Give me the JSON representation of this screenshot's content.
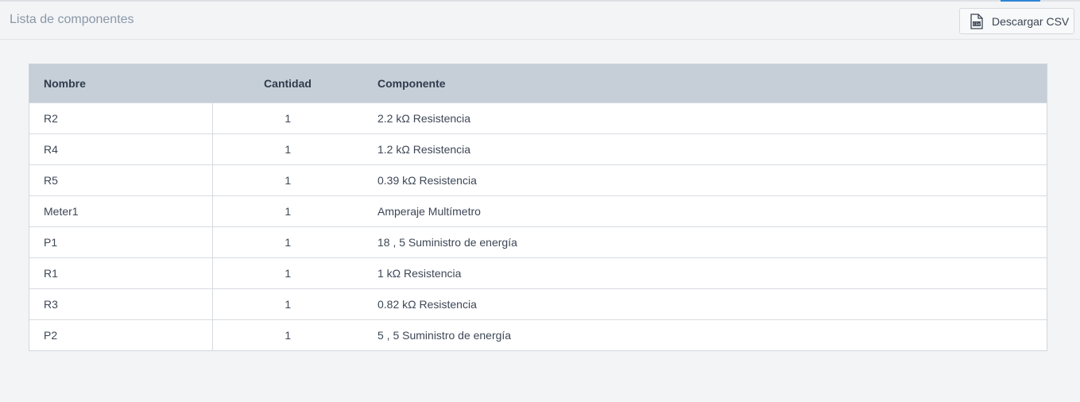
{
  "header": {
    "title": "Lista de componentes",
    "download_label": "Descargar CSV",
    "download_icon": "csv-file-icon"
  },
  "colors": {
    "accent": "#2e86d6",
    "table_header_bg": "#c6ced8",
    "page_bg": "#f3f4f6"
  },
  "table": {
    "columns": [
      "Nombre",
      "Cantidad",
      "Componente"
    ],
    "rows": [
      {
        "name": "R2",
        "qty": "1",
        "component": "2.2 kΩ Resistencia"
      },
      {
        "name": "R4",
        "qty": "1",
        "component": "1.2 kΩ Resistencia"
      },
      {
        "name": "R5",
        "qty": "1",
        "component": "0.39 kΩ Resistencia"
      },
      {
        "name": "Meter1",
        "qty": "1",
        "component": "Amperaje Multímetro"
      },
      {
        "name": "P1",
        "qty": "1",
        "component": "18 , 5 Suministro de energía"
      },
      {
        "name": "R1",
        "qty": "1",
        "component": "1 kΩ Resistencia"
      },
      {
        "name": "R3",
        "qty": "1",
        "component": "0.82 kΩ Resistencia"
      },
      {
        "name": "P2",
        "qty": "1",
        "component": "5 , 5 Suministro de energía"
      }
    ]
  }
}
